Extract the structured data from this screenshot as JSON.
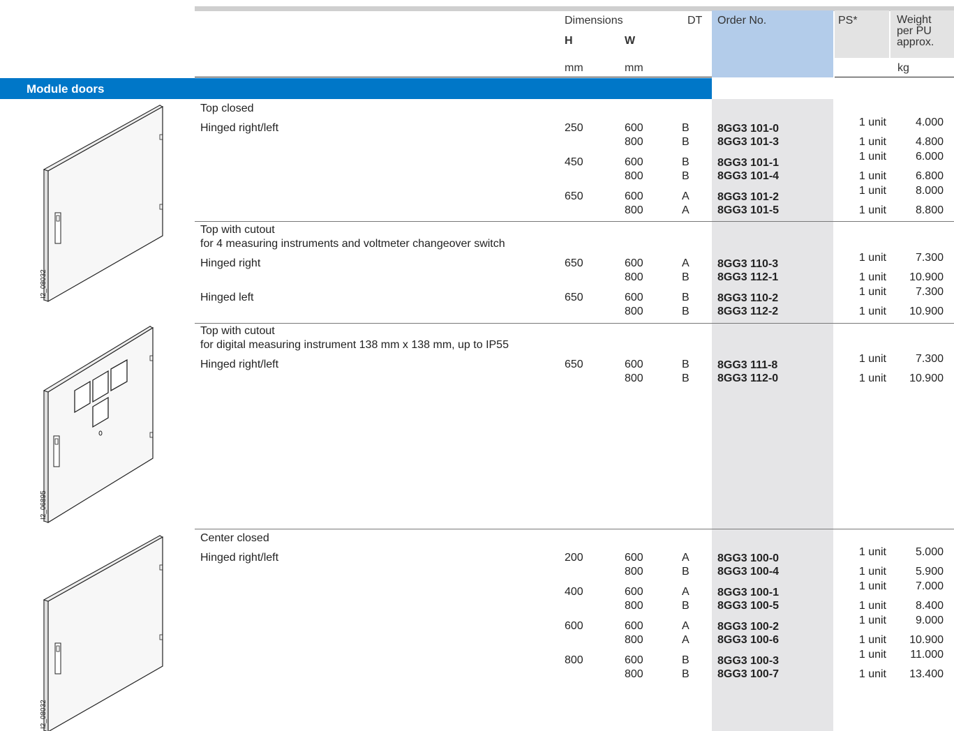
{
  "header": {
    "dimensions": "Dimensions",
    "h": "H",
    "w": "W",
    "dt": "DT",
    "order_no": "Order No.",
    "ps": "PS*",
    "weight_line1": "Weight",
    "weight_line2": "per PU",
    "weight_line3": "approx.",
    "unit_h": "mm",
    "unit_w": "mm",
    "unit_weight": "kg"
  },
  "section_title": "Module doors",
  "image_ids": [
    "I2_08032",
    "I2_06895",
    "I2_08032"
  ],
  "groups": [
    {
      "title_lines": [
        "Top closed"
      ],
      "sublabel": "Hinged right/left",
      "rows": [
        {
          "h": "250",
          "w": "600",
          "dt": "B",
          "order": "8GG3 101-0",
          "ps": "1 unit",
          "weight": "4.000"
        },
        {
          "h": "",
          "w": "800",
          "dt": "B",
          "order": "8GG3 101-3",
          "ps": "1 unit",
          "weight": "4.800"
        },
        {
          "h": "450",
          "w": "600",
          "dt": "B",
          "order": "8GG3 101-1",
          "ps": "1 unit",
          "weight": "6.000"
        },
        {
          "h": "",
          "w": "800",
          "dt": "B",
          "order": "8GG3 101-4",
          "ps": "1 unit",
          "weight": "6.800"
        },
        {
          "h": "650",
          "w": "600",
          "dt": "A",
          "order": "8GG3 101-2",
          "ps": "1 unit",
          "weight": "8.000"
        },
        {
          "h": "",
          "w": "800",
          "dt": "A",
          "order": "8GG3 101-5",
          "ps": "1 unit",
          "weight": "8.800"
        }
      ]
    },
    {
      "title_lines": [
        "Top with cutout",
        "for 4 measuring instruments and voltmeter changeover switch"
      ],
      "sublabels": [
        "Hinged right",
        "Hinged left"
      ],
      "rows": [
        {
          "h": "650",
          "w": "600",
          "dt": "A",
          "order": "8GG3 110-3",
          "ps": "1 unit",
          "weight": "7.300"
        },
        {
          "h": "",
          "w": "800",
          "dt": "B",
          "order": "8GG3 112-1",
          "ps": "1 unit",
          "weight": "10.900"
        },
        {
          "h": "650",
          "w": "600",
          "dt": "B",
          "order": "8GG3 110-2",
          "ps": "1 unit",
          "weight": "7.300"
        },
        {
          "h": "",
          "w": "800",
          "dt": "B",
          "order": "8GG3 112-2",
          "ps": "1 unit",
          "weight": "10.900"
        }
      ]
    },
    {
      "title_lines": [
        "Top with cutout",
        "for digital measuring instrument 138 mm x 138 mm, up to IP55"
      ],
      "sublabel": "Hinged right/left",
      "rows": [
        {
          "h": "650",
          "w": "600",
          "dt": "B",
          "order": "8GG3 111-8",
          "ps": "1 unit",
          "weight": "7.300"
        },
        {
          "h": "",
          "w": "800",
          "dt": "B",
          "order": "8GG3 112-0",
          "ps": "1 unit",
          "weight": "10.900"
        }
      ]
    },
    {
      "title_lines": [
        "Center closed"
      ],
      "sublabel": "Hinged right/left",
      "rows": [
        {
          "h": "200",
          "w": "600",
          "dt": "A",
          "order": "8GG3 100-0",
          "ps": "1 unit",
          "weight": "5.000"
        },
        {
          "h": "",
          "w": "800",
          "dt": "B",
          "order": "8GG3 100-4",
          "ps": "1 unit",
          "weight": "5.900"
        },
        {
          "h": "400",
          "w": "600",
          "dt": "A",
          "order": "8GG3 100-1",
          "ps": "1 unit",
          "weight": "7.000"
        },
        {
          "h": "",
          "w": "800",
          "dt": "B",
          "order": "8GG3 100-5",
          "ps": "1 unit",
          "weight": "8.400"
        },
        {
          "h": "600",
          "w": "600",
          "dt": "A",
          "order": "8GG3 100-2",
          "ps": "1 unit",
          "weight": "9.000"
        },
        {
          "h": "",
          "w": "800",
          "dt": "A",
          "order": "8GG3 100-6",
          "ps": "1 unit",
          "weight": "10.900"
        },
        {
          "h": "800",
          "w": "600",
          "dt": "B",
          "order": "8GG3 100-3",
          "ps": "1 unit",
          "weight": "11.000"
        },
        {
          "h": "",
          "w": "800",
          "dt": "B",
          "order": "8GG3 100-7",
          "ps": "1 unit",
          "weight": "13.400"
        }
      ]
    }
  ]
}
